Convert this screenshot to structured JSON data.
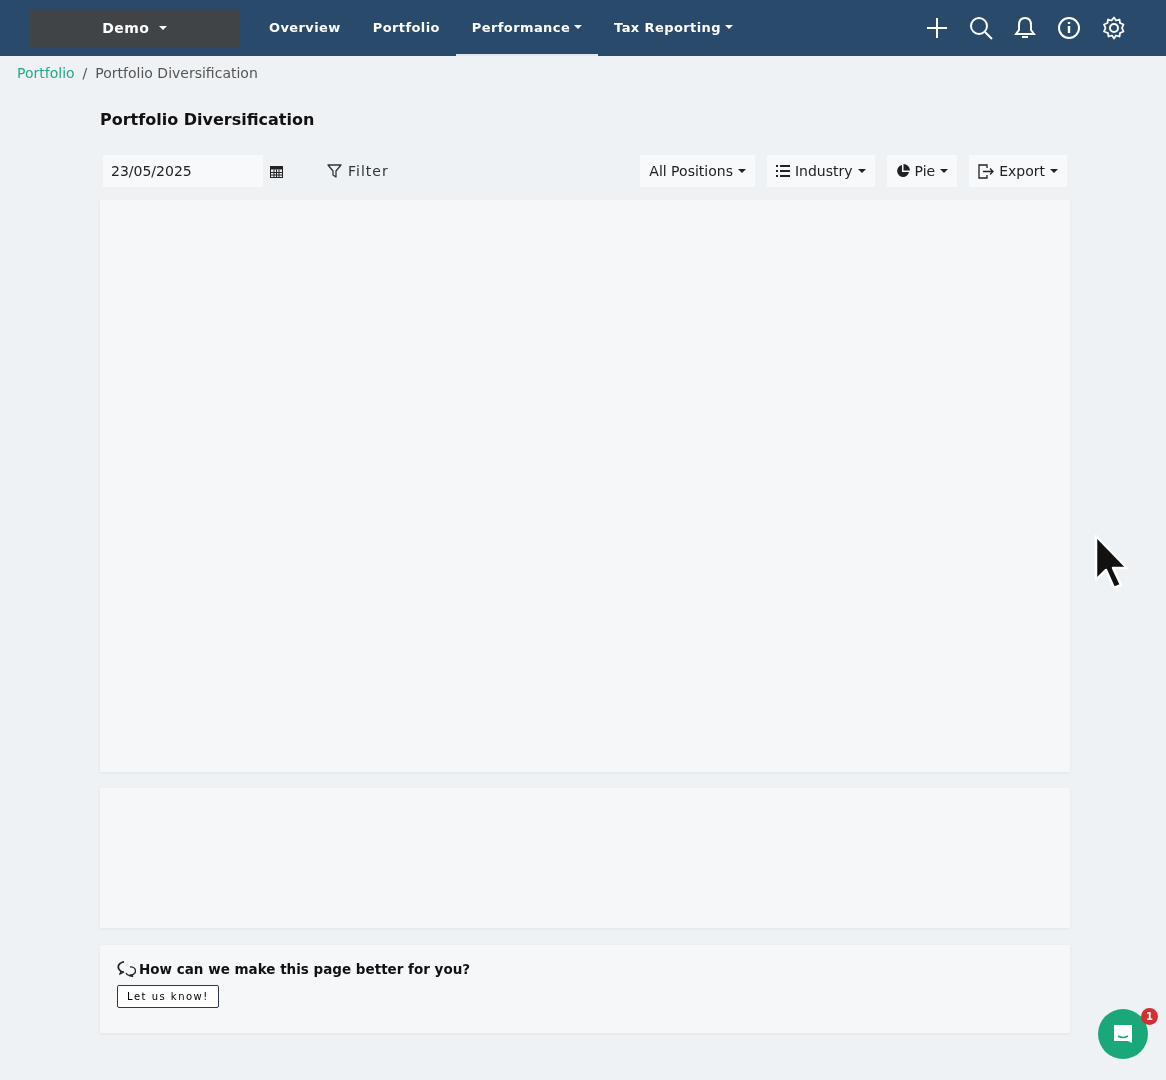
{
  "account_menu": {
    "label": "Demo"
  },
  "nav": [
    {
      "label": "Overview",
      "selected": false,
      "dropdown": false
    },
    {
      "label": "Portfolio",
      "selected": false,
      "dropdown": false
    },
    {
      "label": "Performance",
      "selected": true,
      "dropdown": true
    },
    {
      "label": "Tax Reporting",
      "selected": false,
      "dropdown": true
    }
  ],
  "breadcrumb_separator": "/",
  "breadcrumb": [
    {
      "label": "Portfolio",
      "link": true
    },
    {
      "label": "Portfolio Diversification",
      "link": false
    }
  ],
  "page_title": "Portfolio Diversification",
  "toolbar": {
    "date": "23/05/2025",
    "filter": "Filter",
    "buttons": [
      {
        "kind": "plain",
        "label": "All Positions"
      },
      {
        "kind": "list",
        "label": "Industry"
      },
      {
        "kind": "pie",
        "label": "Pie"
      },
      {
        "kind": "export",
        "label": "Export"
      }
    ]
  },
  "feedback": {
    "question": "How can we make this page better for you?",
    "button": "Let us know!"
  },
  "chat": {
    "badge": "1"
  }
}
